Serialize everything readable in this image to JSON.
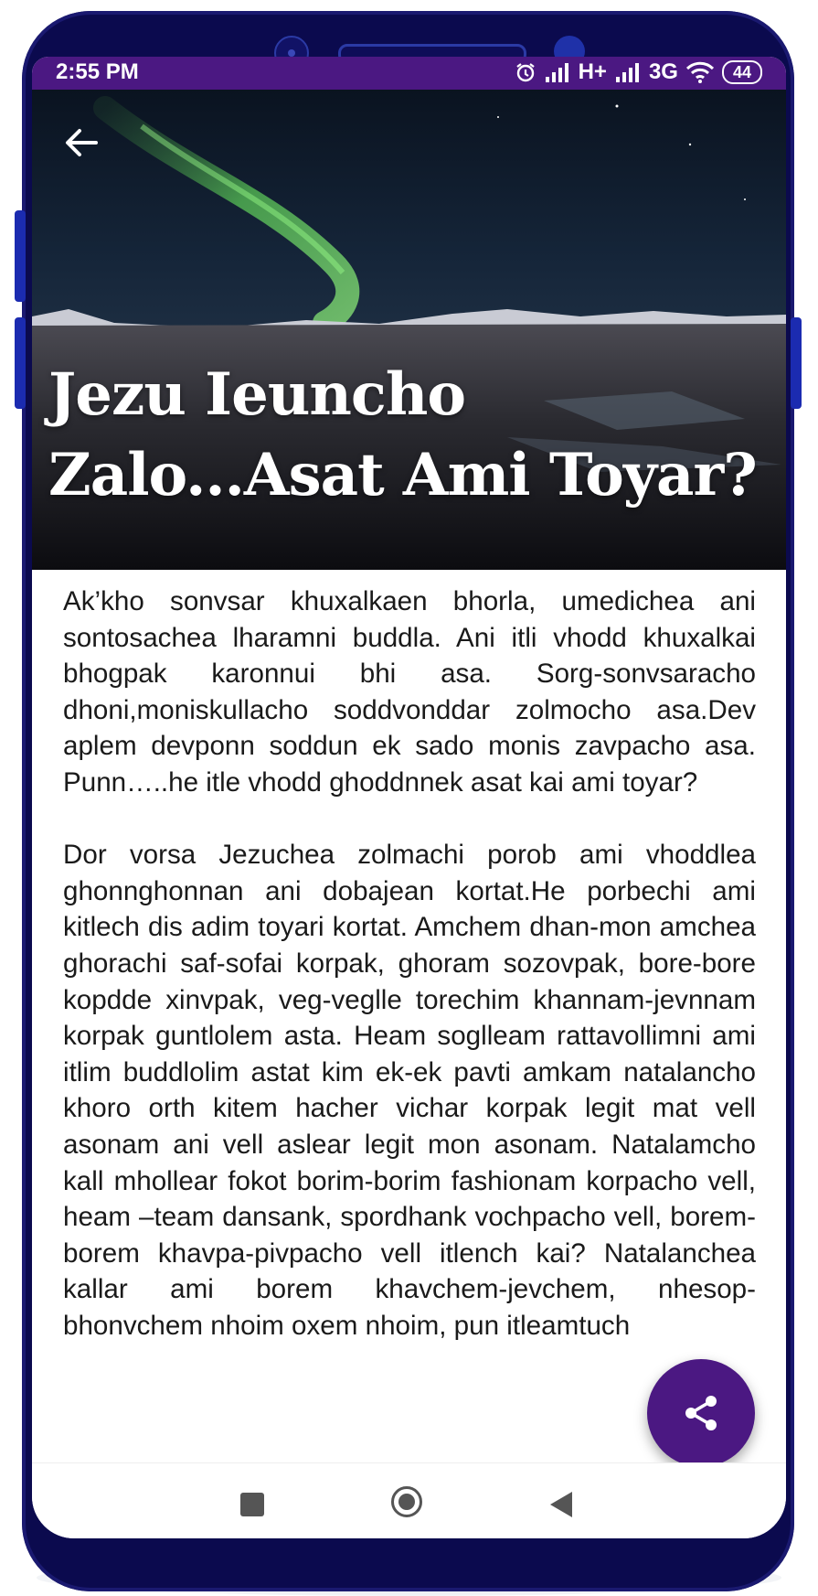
{
  "status_bar": {
    "time": "2:55 PM",
    "network_1": "H+",
    "network_2": "3G",
    "battery": "44"
  },
  "article": {
    "title": "Jezu Ieuncho Zalo...Asat Ami Toyar?",
    "paragraphs": [
      "Ak’kho sonvsar khuxalkaen bhorla, umedichea ani sontosachea lharamni buddla. Ani itli vhodd khuxalkai bhogpak karonnui bhi asa. Sorg-sonvsaracho dhoni,moniskullacho soddvonddar zolmocho asa.Dev aplem devponn soddun ek sado monis zavpacho asa. Punn…..he itle vhodd ghoddnnek asat kai ami toyar?",
      "Dor vorsa Jezuchea zolmachi porob ami vhoddlea ghonnghonnan ani dobajean kortat.He porbechi ami kitlech dis adim toyari kortat. Amchem dhan-mon amchea ghorachi saf-sofai korpak, ghoram sozovpak, bore-bore kopdde xinvpak, veg-veglle torechim khannam-jevnnam korpak guntlolem asta. Heam soglleam rattavollimni ami itlim buddlolim astat kim ek-ek pavti amkam natalancho khoro orth kitem hacher vichar korpak legit mat vell asonam ani vell aslear legit mon asonam. Natalamcho kall mhollear fokot borim-borim fashionam korpacho vell, heam –team dansank, spordhank vochpacho vell, borem-borem khavpa-pivpacho vell itlench kai? Natalanchea kallar ami borem khavchem-jevchem, nhesop-bhonvchem nhoim oxem nhoim, pun itleamtuch"
    ]
  },
  "icons": {
    "back": "arrow-left-icon",
    "share": "share-icon",
    "alarm": "alarm-icon",
    "wifi": "wifi-icon"
  },
  "colors": {
    "frame": "#0b0a4e",
    "status_bar": "#4b1882",
    "fab": "#4b1882"
  }
}
